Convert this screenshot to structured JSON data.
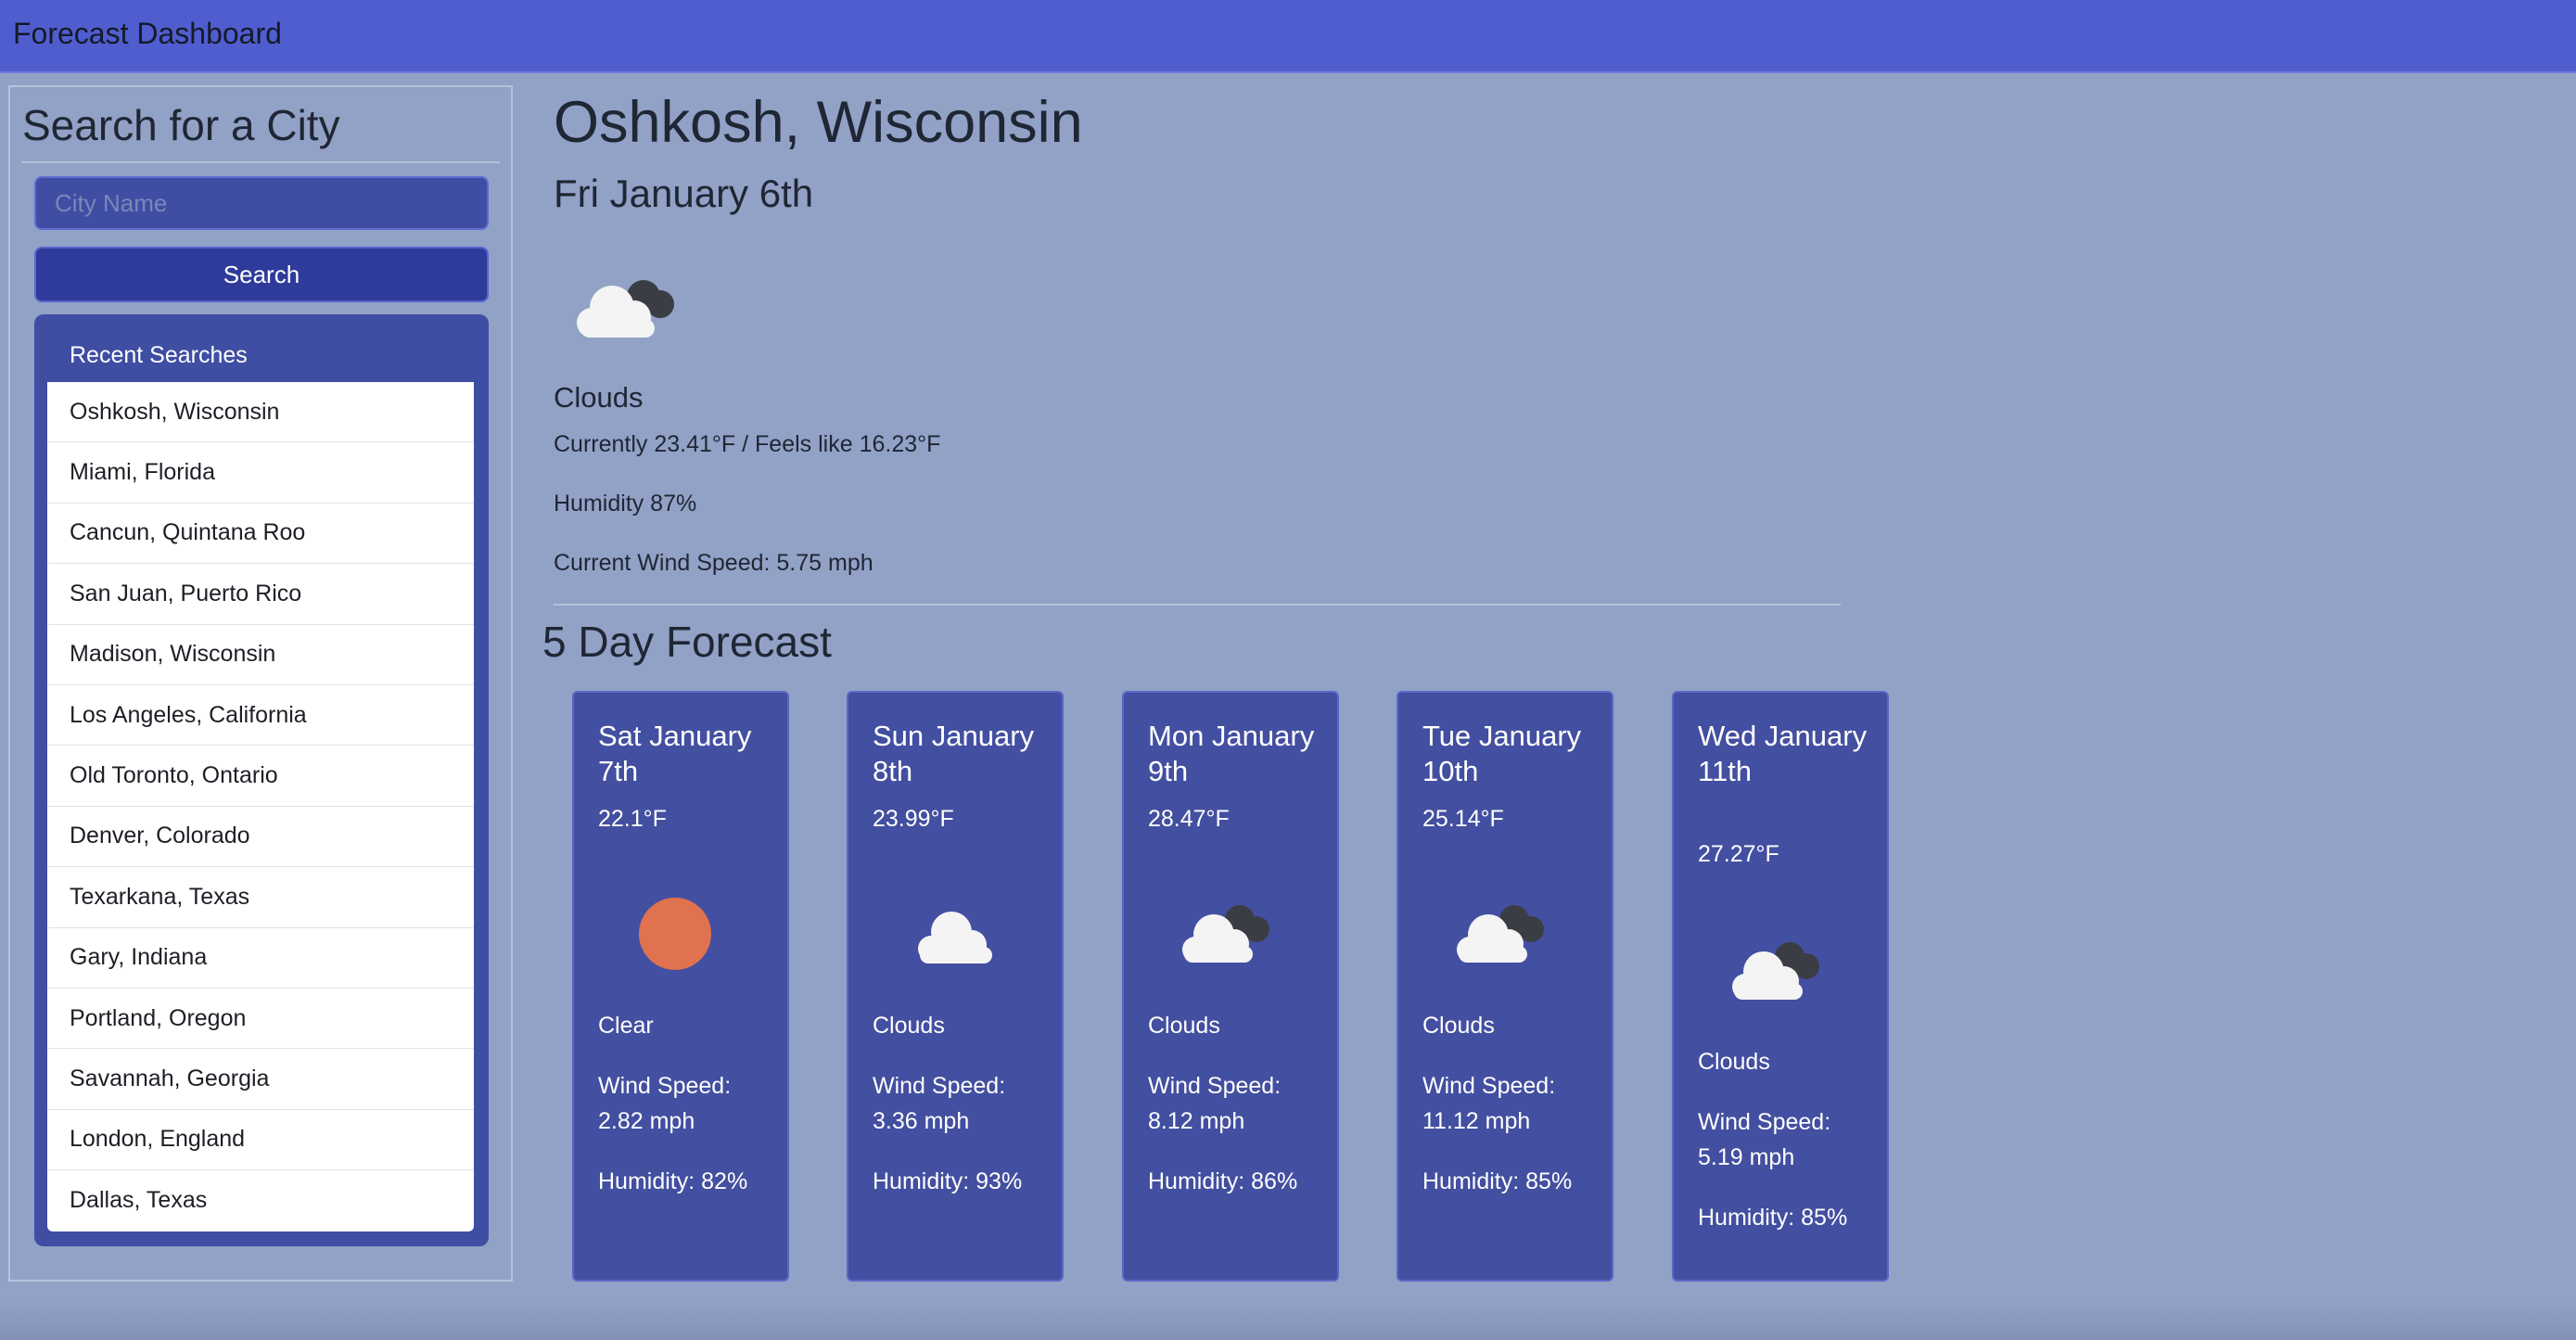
{
  "header": {
    "title": "Forecast Dashboard"
  },
  "sidebar": {
    "title": "Search for a City",
    "search": {
      "placeholder": "City Name",
      "value": "",
      "button_label": "Search"
    },
    "recent": {
      "label": "Recent Searches",
      "items": [
        "Oshkosh, Wisconsin",
        "Miami, Florida",
        "Cancun, Quintana Roo",
        "San Juan, Puerto Rico",
        "Madison, Wisconsin",
        "Los Angeles, California",
        "Old Toronto, Ontario",
        "Denver, Colorado",
        "Texarkana, Texas",
        "Gary, Indiana",
        "Portland, Oregon",
        "Savannah, Georgia",
        "London, England",
        "Dallas, Texas"
      ]
    }
  },
  "current": {
    "city": "Oshkosh, Wisconsin",
    "date": "Fri January 6th",
    "icon": "clouds-icon",
    "conditions": "Clouds",
    "temperature_line": "Currently 23.41°F / Feels like 16.23°F",
    "humidity_line": "Humidity 87%",
    "wind_line": "Current Wind Speed: 5.75 mph"
  },
  "forecast": {
    "title": "5 Day Forecast",
    "days": [
      {
        "date": "Sat January 7th",
        "temp": "22.1°F",
        "icon": "sun-icon",
        "conditions": "Clear",
        "wind": "Wind Speed: 2.82 mph",
        "humidity": "Humidity: 82%"
      },
      {
        "date": "Sun January 8th",
        "temp": "23.99°F",
        "icon": "cloud-icon",
        "conditions": "Clouds",
        "wind": "Wind Speed: 3.36 mph",
        "humidity": "Humidity: 93%"
      },
      {
        "date": "Mon January 9th",
        "temp": "28.47°F",
        "icon": "clouds-icon",
        "conditions": "Clouds",
        "wind": "Wind Speed: 8.12 mph",
        "humidity": "Humidity: 86%"
      },
      {
        "date": "Tue January 10th",
        "temp": "25.14°F",
        "icon": "clouds-icon",
        "conditions": "Clouds",
        "wind": "Wind Speed: 11.12 mph",
        "humidity": "Humidity: 85%"
      },
      {
        "date": "Wed January 11th",
        "temp": "27.27°F",
        "icon": "clouds-icon",
        "conditions": "Clouds",
        "wind": "Wind Speed: 5.19 mph",
        "humidity": "Humidity: 85%"
      }
    ]
  },
  "colors": {
    "navbar": "#4f5dcf",
    "page_background": "#92a1c6",
    "card": "#434fa0",
    "button": "#2f3b9a",
    "sun": "#e07250"
  }
}
